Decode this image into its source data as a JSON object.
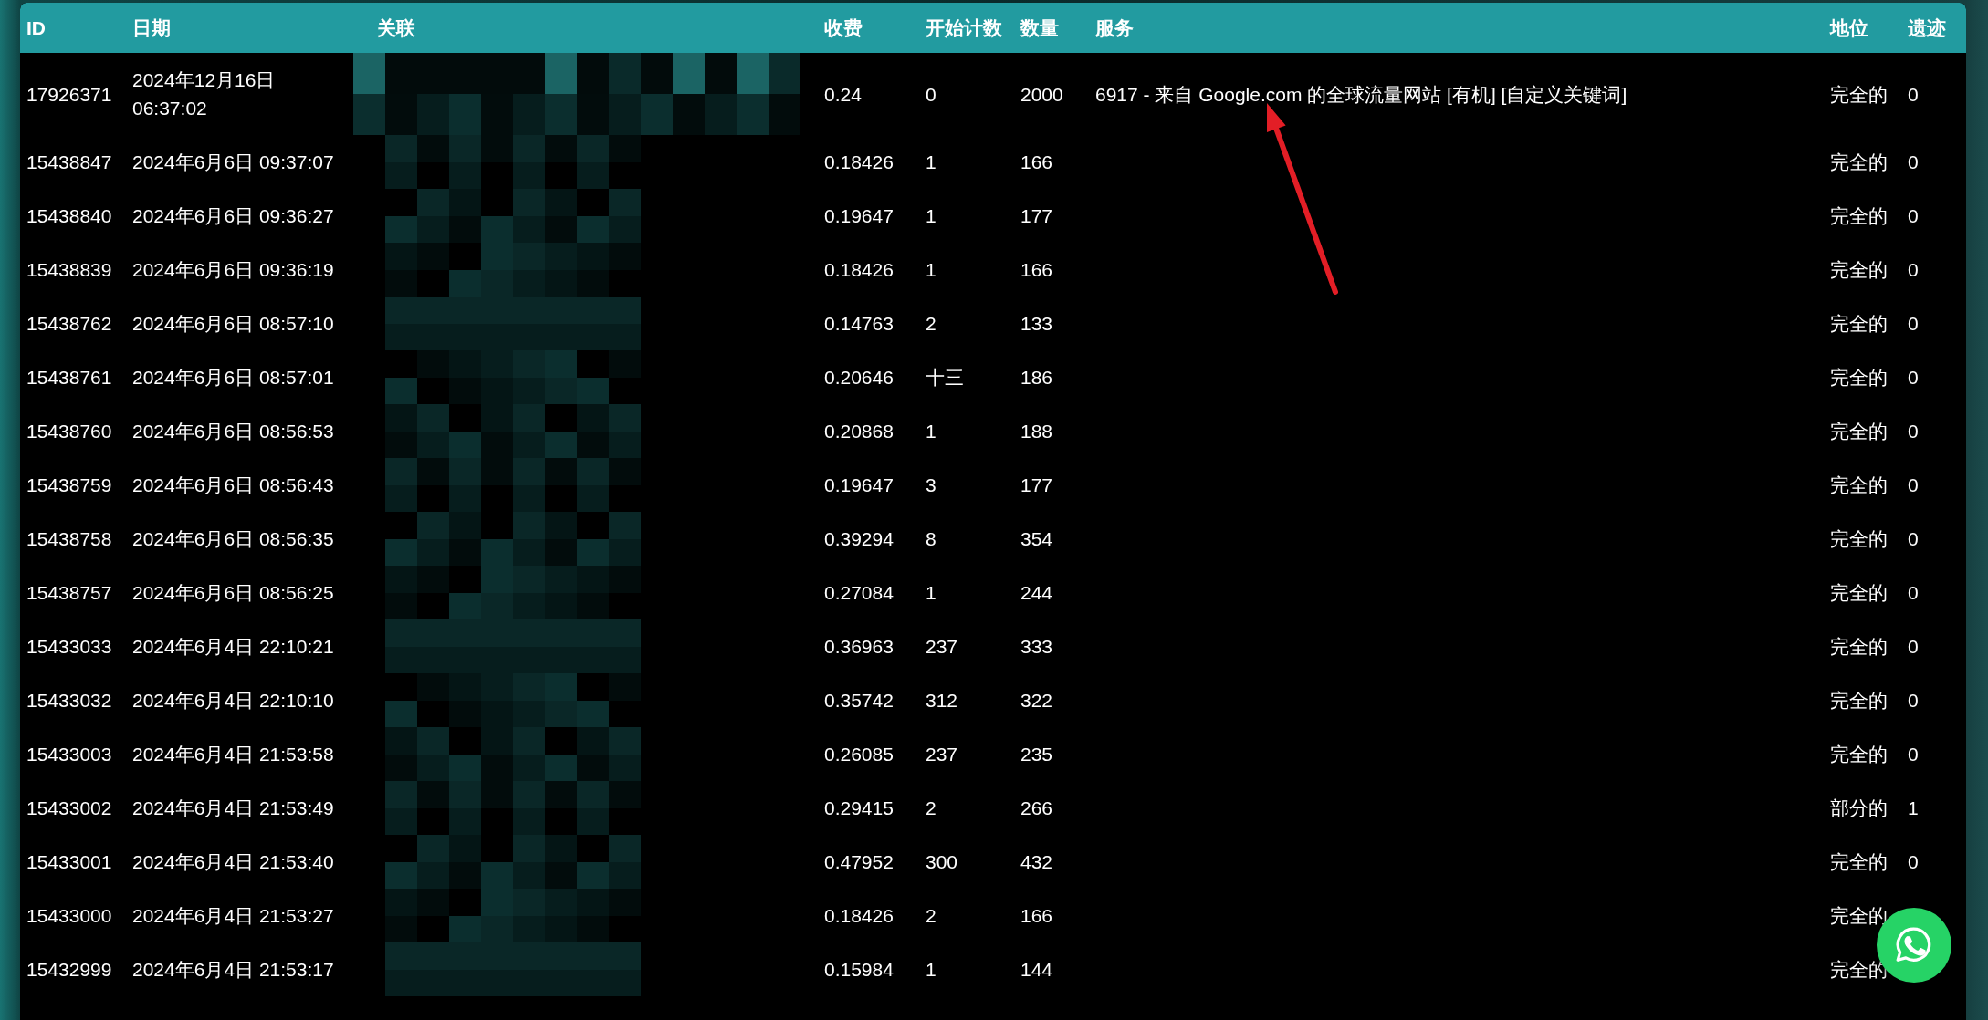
{
  "table": {
    "columns": [
      "ID",
      "日期",
      "关联",
      "收费",
      "开始计数",
      "数量",
      "服务",
      "地位",
      "遗迹"
    ],
    "rows": [
      {
        "id": "17926371",
        "date": "2024年12月16日 06:37:02",
        "charge": "0.24",
        "start_count": "0",
        "quantity": "2000",
        "service": "6917 - 来自 Google.com 的全球流量网站 [有机] [自定义关键词]",
        "status": "完全的",
        "remains": "0"
      },
      {
        "id": "15438847",
        "date": "2024年6月6日 09:37:07",
        "charge": "0.18426",
        "start_count": "1",
        "quantity": "166",
        "status": "完全的",
        "remains": "0"
      },
      {
        "id": "15438840",
        "date": "2024年6月6日 09:36:27",
        "charge": "0.19647",
        "start_count": "1",
        "quantity": "177",
        "status": "完全的",
        "remains": "0"
      },
      {
        "id": "15438839",
        "date": "2024年6月6日 09:36:19",
        "charge": "0.18426",
        "start_count": "1",
        "quantity": "166",
        "status": "完全的",
        "remains": "0"
      },
      {
        "id": "15438762",
        "date": "2024年6月6日 08:57:10",
        "charge": "0.14763",
        "start_count": "2",
        "quantity": "133",
        "status": "完全的",
        "remains": "0"
      },
      {
        "id": "15438761",
        "date": "2024年6月6日 08:57:01",
        "charge": "0.20646",
        "start_count": "十三",
        "quantity": "186",
        "status": "完全的",
        "remains": "0"
      },
      {
        "id": "15438760",
        "date": "2024年6月6日 08:56:53",
        "charge": "0.20868",
        "start_count": "1",
        "quantity": "188",
        "status": "完全的",
        "remains": "0"
      },
      {
        "id": "15438759",
        "date": "2024年6月6日 08:56:43",
        "charge": "0.19647",
        "start_count": "3",
        "quantity": "177",
        "status": "完全的",
        "remains": "0"
      },
      {
        "id": "15438758",
        "date": "2024年6月6日 08:56:35",
        "charge": "0.39294",
        "start_count": "8",
        "quantity": "354",
        "status": "完全的",
        "remains": "0"
      },
      {
        "id": "15438757",
        "date": "2024年6月6日 08:56:25",
        "charge": "0.27084",
        "start_count": "1",
        "quantity": "244",
        "status": "完全的",
        "remains": "0"
      },
      {
        "id": "15433033",
        "date": "2024年6月4日 22:10:21",
        "charge": "0.36963",
        "start_count": "237",
        "quantity": "333",
        "status": "完全的",
        "remains": "0"
      },
      {
        "id": "15433032",
        "date": "2024年6月4日 22:10:10",
        "charge": "0.35742",
        "start_count": "312",
        "quantity": "322",
        "status": "完全的",
        "remains": "0"
      },
      {
        "id": "15433003",
        "date": "2024年6月4日 21:53:58",
        "charge": "0.26085",
        "start_count": "237",
        "quantity": "235",
        "status": "完全的",
        "remains": "0"
      },
      {
        "id": "15433002",
        "date": "2024年6月4日 21:53:49",
        "charge": "0.29415",
        "start_count": "2",
        "quantity": "266",
        "status": "部分的",
        "remains": "1"
      },
      {
        "id": "15433001",
        "date": "2024年6月4日 21:53:40",
        "charge": "0.47952",
        "start_count": "300",
        "quantity": "432",
        "status": "完全的",
        "remains": "0"
      },
      {
        "id": "15433000",
        "date": "2024年6月4日 21:53:27",
        "charge": "0.18426",
        "start_count": "2",
        "quantity": "166",
        "status": "完全的"
      },
      {
        "id": "15432999",
        "date": "2024年6月4日 21:53:17",
        "charge": "0.15984",
        "start_count": "1",
        "quantity": "144",
        "status": "完全的"
      }
    ]
  }
}
